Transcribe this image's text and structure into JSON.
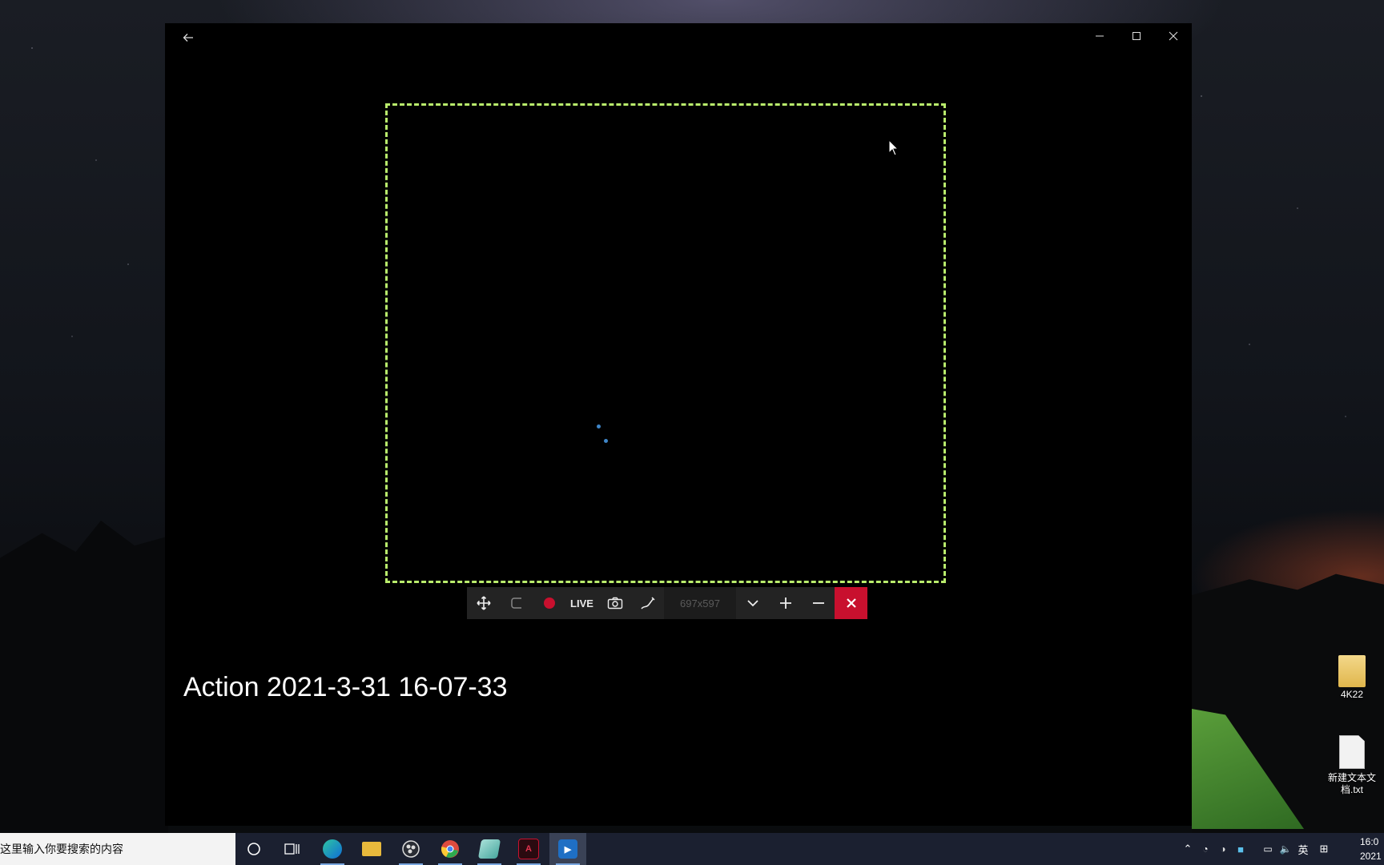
{
  "window": {
    "back_icon": "back-arrow-icon",
    "minimize_icon": "minimize-icon",
    "maximize_icon": "maximize-icon",
    "close_icon": "close-icon"
  },
  "capture": {
    "title": "Action 2021-3-31 16-07-33"
  },
  "toolbar": {
    "live_label": "LIVE",
    "size_label": "697x597",
    "buttons": [
      "move-icon",
      "region-icon",
      "record-icon",
      "live",
      "camera-icon",
      "draw-icon",
      "size",
      "chevron-down-icon",
      "plus-icon",
      "minus-icon",
      "close-icon"
    ]
  },
  "desktop": {
    "icons": [
      {
        "label": "4K22",
        "icon": "folder-icon"
      },
      {
        "label": "新建文本文档.txt",
        "icon": "text-file-icon"
      }
    ]
  },
  "taskbar": {
    "search_placeholder": "在这里输入你要搜索的内容",
    "ime_label": "英",
    "clock_time": "16:0",
    "clock_date": "2021"
  },
  "colors": {
    "frame": "#b9ec6c",
    "record": "#c8102e",
    "close_accent": "#c8102e",
    "taskbar": "#1b2030"
  }
}
